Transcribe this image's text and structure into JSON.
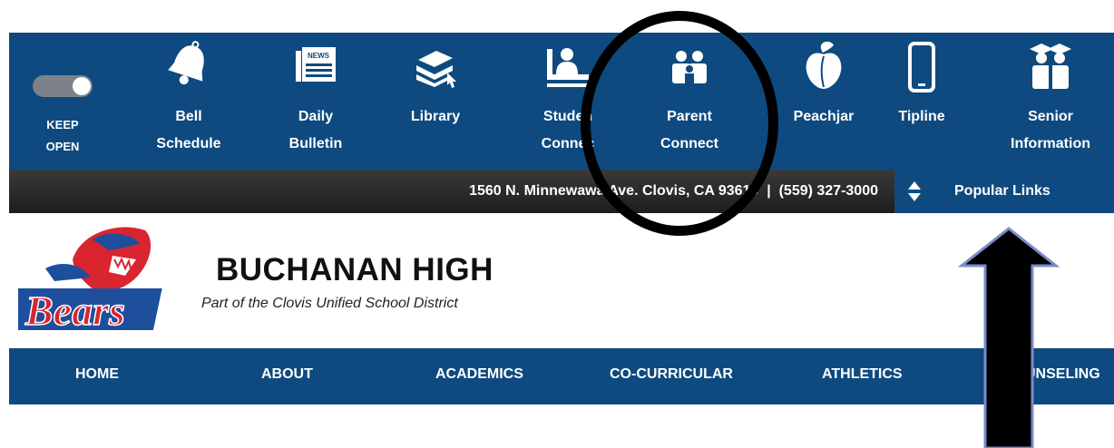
{
  "quickbar": {
    "keep_open": {
      "line1": "KEEP",
      "line2": "OPEN"
    },
    "items": [
      {
        "line1": "Bell",
        "line2": "Schedule",
        "icon": "bell-icon"
      },
      {
        "line1": "Daily",
        "line2": "Bulletin",
        "icon": "newspaper-icon",
        "icon_text": "NEWS"
      },
      {
        "line1": "Library",
        "line2": "",
        "icon": "books-icon"
      },
      {
        "line1": "Studen",
        "line2": "Connec",
        "icon": "student-desk-icon"
      },
      {
        "line1": "Parent",
        "line2": "Connect",
        "icon": "parents-icon"
      },
      {
        "line1": "Peachjar",
        "line2": "",
        "icon": "peach-icon"
      },
      {
        "line1": "Tipline",
        "line2": "",
        "icon": "smartphone-icon"
      },
      {
        "line1": "Senior",
        "line2": "Information",
        "icon": "graduates-icon"
      }
    ]
  },
  "address_bar": {
    "text": "1560 N. Minnewawa Ave. Clovis, CA 93619  |  (559) 327-3000"
  },
  "popular_links": {
    "label": "Popular Links",
    "icon": "sort-arrows-icon"
  },
  "school": {
    "name": "BUCHANAN HIGH",
    "district": "Part of the Clovis Unified School District",
    "logo_text": "Bears"
  },
  "main_nav": [
    {
      "label": "HOME"
    },
    {
      "label": "ABOUT"
    },
    {
      "label": "ACADEMICS"
    },
    {
      "label": "CO-CURRICULAR"
    },
    {
      "label": "ATHLETICS"
    },
    {
      "label": "COUNSELING"
    }
  ],
  "colors": {
    "brand_blue": "#0e4a7f",
    "address_bar": "#262626",
    "logo_red": "#d8252f",
    "logo_blue": "#1d4f9c"
  }
}
